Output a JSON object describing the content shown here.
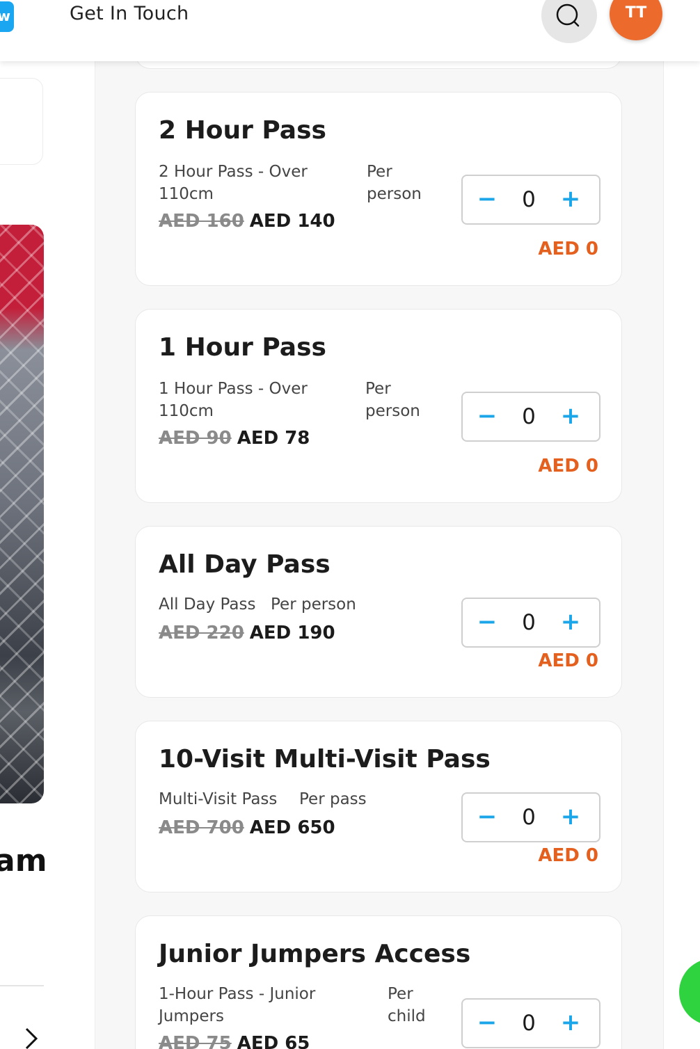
{
  "header": {
    "logo_letter": "w",
    "nav_link": "Get In Touch",
    "avatar_initials": "TT"
  },
  "left": {
    "heading_fragment": "am"
  },
  "currency_note": "AED",
  "tickets": [
    {
      "title": "2 Hour Pass",
      "description": "2 Hour Pass - Over 110cm",
      "unit": "Per person",
      "old_price": "AED 160",
      "new_price": "AED 140",
      "quantity": "0",
      "subtotal": "AED 0"
    },
    {
      "title": "1 Hour Pass",
      "description": "1 Hour Pass - Over 110cm",
      "unit": "Per person",
      "old_price": "AED 90",
      "new_price": "AED 78",
      "quantity": "0",
      "subtotal": "AED 0"
    },
    {
      "title": "All Day Pass",
      "description": "All Day Pass",
      "unit": "Per person",
      "old_price": "AED 220",
      "new_price": "AED 190",
      "quantity": "0",
      "subtotal": "AED 0"
    },
    {
      "title": "10-Visit Multi-Visit Pass",
      "description": "Multi-Visit Pass",
      "unit": "Per pass",
      "old_price": "AED 700",
      "new_price": "AED 650",
      "quantity": "0",
      "subtotal": "AED 0"
    },
    {
      "title": "Junior Jumpers Access",
      "description": "1-Hour Pass - Junior Jumpers",
      "unit": "Per child",
      "old_price": "AED 75",
      "new_price": "AED 65",
      "quantity": "0",
      "subtotal": "AED 0"
    }
  ],
  "stepper": {
    "minus": "−",
    "plus": "+"
  },
  "icons": {
    "search": "search-icon",
    "chevron": "chevron-right-icon",
    "whatsapp": "whatsapp-icon"
  },
  "colors": {
    "accent_blue": "#1aa6e8",
    "price_orange": "#e4601f",
    "avatar_orange": "#ec6a2c"
  }
}
